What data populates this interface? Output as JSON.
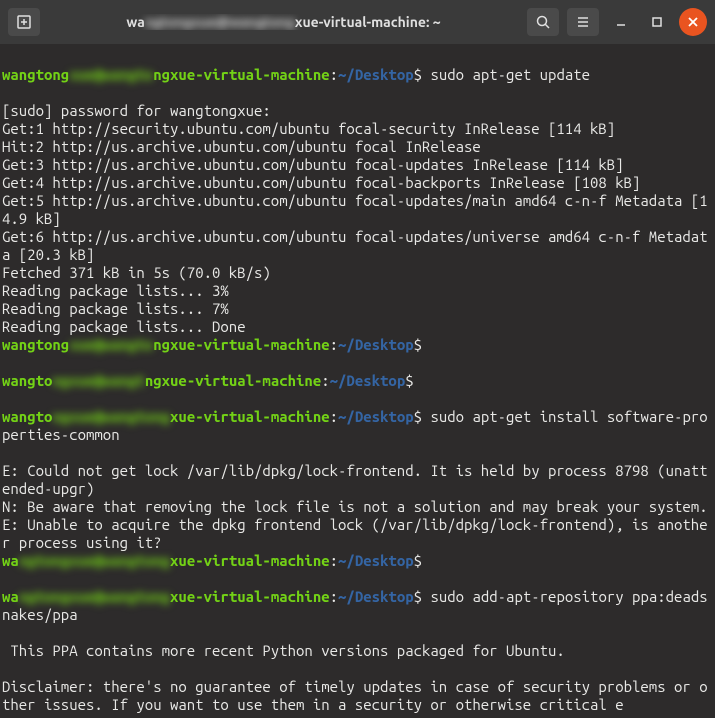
{
  "titlebar": {
    "title_prefix": "wa",
    "title_blur": "ngtongxue@wangtong",
    "title_suffix": "xue-virtual-machine: ~"
  },
  "prompt": {
    "user_prefix": "wangtong",
    "user_blur": "xue@wangto",
    "user_suffix": "ngxue-virtual-machine",
    "colon": ":",
    "path": "~/Desktop",
    "dollar": "$"
  },
  "cmd1": "sudo apt-get update",
  "cmd2": "",
  "cmd3": "sudo apt-get install software-properties-common",
  "cmd4": "",
  "cmd5": "sudo add-apt-repository ppa:deadsnakes/ppa",
  "line_sudo": "[sudo] password for wangtongxue:",
  "line_get1": "Get:1 http://security.ubuntu.com/ubuntu focal-security InRelease [114 kB]",
  "line_hit2": "Hit:2 http://us.archive.ubuntu.com/ubuntu focal InRelease",
  "line_get3": "Get:3 http://us.archive.ubuntu.com/ubuntu focal-updates InRelease [114 kB]",
  "line_get4": "Get:4 http://us.archive.ubuntu.com/ubuntu focal-backports InRelease [108 kB]",
  "line_get5": "Get:5 http://us.archive.ubuntu.com/ubuntu focal-updates/main amd64 c-n-f Metadata [14.9 kB]",
  "line_get6": "Get:6 http://us.archive.ubuntu.com/ubuntu focal-updates/universe amd64 c-n-f Metadata [20.3 kB]",
  "line_fetched": "Fetched 371 kB in 5s (70.0 kB/s)",
  "line_read3": "Reading package lists... 3%",
  "line_read7": "Reading package lists... 7%",
  "line_readdone": "Reading package lists... Done",
  "line_errlock": "E: Could not get lock /var/lib/dpkg/lock-frontend. It is held by process 8798 (unattended-upgr)",
  "line_nbeware": "N: Be aware that removing the lock file is not a solution and may break your system.",
  "line_errunable": "E: Unable to acquire the dpkg frontend lock (/var/lib/dpkg/lock-frontend), is another process using it?",
  "line_ppa1": " This PPA contains more recent Python versions packaged for Ubuntu.",
  "line_disc": "Disclaimer: there's no guarantee of timely updates in case of security problems or other issues. If you want to use them in a security or otherwise critical e"
}
